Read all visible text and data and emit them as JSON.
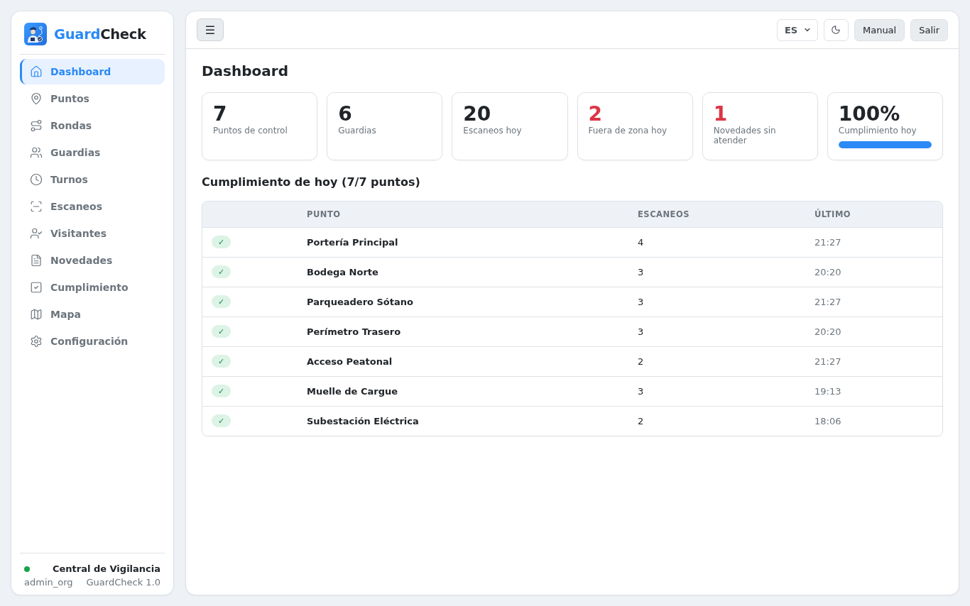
{
  "sidebar": {
    "brand": {
      "first": "Guard",
      "second": "Check"
    },
    "nav_items": [
      {
        "label": "Dashboard",
        "selected": true
      },
      {
        "label": "Puntos",
        "selected": false
      },
      {
        "label": "Rondas",
        "selected": false
      },
      {
        "label": "Guardias",
        "selected": false
      },
      {
        "label": "Turnos",
        "selected": false
      },
      {
        "label": "Escaneos",
        "selected": false
      },
      {
        "label": "Visitantes",
        "selected": false
      },
      {
        "label": "Novedades",
        "selected": false
      },
      {
        "label": "Cumplimiento",
        "selected": false
      },
      {
        "label": "Mapa",
        "selected": false
      },
      {
        "label": "Configuración",
        "selected": false
      }
    ],
    "footer": {
      "online": true,
      "org_name": "Central de Vigilancia",
      "user": "admin_org",
      "version": "GuardCheck 1.0"
    }
  },
  "topbar": {
    "menu_button": "☰",
    "language": "ES",
    "buttons": [
      "Manual",
      "Salir"
    ]
  },
  "page_title": "Dashboard",
  "stat_cards": [
    {
      "kind": "count",
      "value": "7",
      "label": "Puntos de control",
      "alert": false
    },
    {
      "kind": "count",
      "value": "6",
      "label": "Guardias",
      "alert": false
    },
    {
      "kind": "count",
      "value": "20",
      "label": "Escaneos hoy",
      "alert": false
    },
    {
      "kind": "count",
      "value": "2",
      "label": "Fuera de zona hoy",
      "alert": true
    },
    {
      "kind": "count",
      "value": "1",
      "label": "Novedades sin atender",
      "alert": true
    },
    {
      "kind": "progress",
      "value": "100%",
      "label": "Cumplimiento hoy",
      "alert": false,
      "level": 1
    }
  ],
  "compliance": {
    "title": "Cumplimiento de hoy (7/7 puntos)",
    "columns": [
      "PUNTO",
      "ESCANEOS",
      "ÚLTIMO"
    ],
    "rows": [
      {
        "status": "✓",
        "point": "Portería Principal",
        "scans": "4",
        "last": "21:27"
      },
      {
        "status": "✓",
        "point": "Bodega Norte",
        "scans": "3",
        "last": "20:20"
      },
      {
        "status": "✓",
        "point": "Parqueadero Sótano",
        "scans": "3",
        "last": "21:27"
      },
      {
        "status": "✓",
        "point": "Perímetro Trasero",
        "scans": "3",
        "last": "20:20"
      },
      {
        "status": "✓",
        "point": "Acceso Peatonal",
        "scans": "2",
        "last": "21:27"
      },
      {
        "status": "✓",
        "point": "Muelle de Cargue",
        "scans": "3",
        "last": "19:13"
      },
      {
        "status": "✓",
        "point": "Subestación Eléctrica",
        "scans": "2",
        "last": "18:06"
      }
    ]
  }
}
